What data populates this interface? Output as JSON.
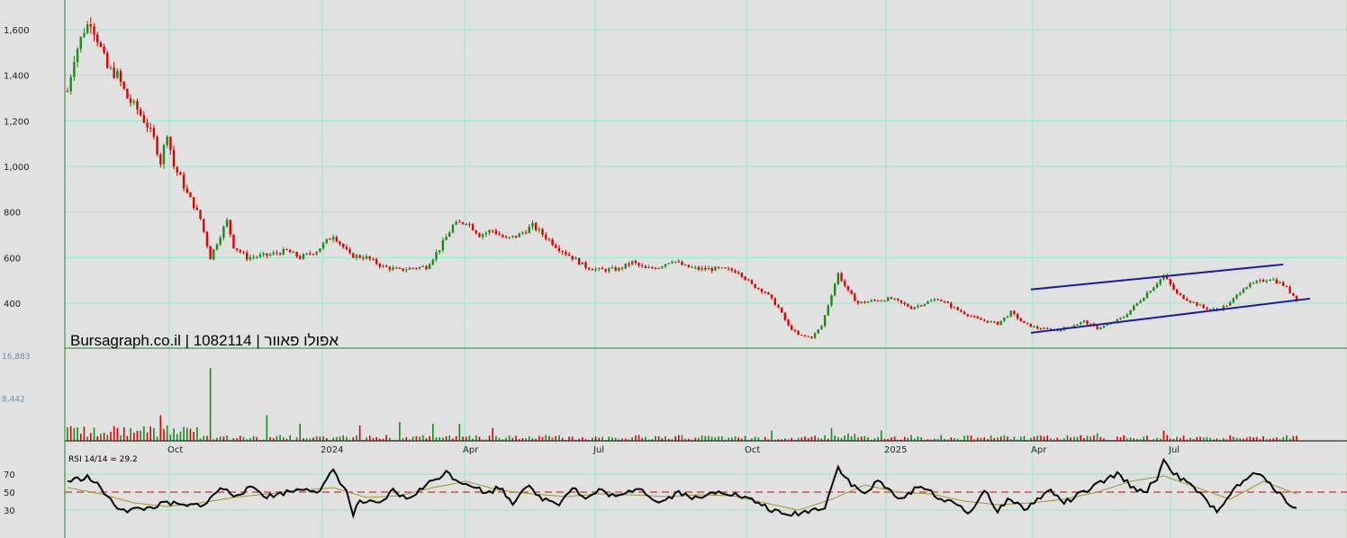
{
  "header": {
    "title": "Bursagraph.co.il | 1082114 | אפולו פאוור"
  },
  "colors": {
    "up": "#1a8a1a",
    "down": "#e00000",
    "grid": "#8ff0c8",
    "channel": "#1a1a9c",
    "rsi": "#000000",
    "rsi_ma": "#9a9a2a",
    "rsi_mid": "#d83030"
  },
  "chart_data": {
    "type": "candlestick",
    "price_axis": {
      "ticks": [
        400,
        600,
        800,
        1000,
        1200,
        1400,
        1600
      ],
      "tick_labels": [
        "400",
        "600",
        "800",
        "1,000",
        "1,200",
        "1,400",
        "1,600"
      ]
    },
    "volume_axis": {
      "ticks": [
        8442,
        16883
      ],
      "tick_labels": [
        "8,442",
        "16,883"
      ]
    },
    "rsi": {
      "label": "RSI 14/14 = 29.2",
      "ticks": [
        30,
        50,
        70
      ],
      "tick_labels": [
        "30",
        "50",
        "70"
      ],
      "last": 29.2
    },
    "x_labels": [
      "Oct",
      "2024",
      "Apr",
      "Jul",
      "Oct",
      "2025",
      "Apr",
      "Jul"
    ],
    "price_path": [
      [
        0,
        1330
      ],
      [
        2,
        1480
      ],
      [
        5,
        1600
      ],
      [
        7,
        1640
      ],
      [
        9,
        1560
      ],
      [
        12,
        1430
      ],
      [
        15,
        1400
      ],
      [
        18,
        1300
      ],
      [
        21,
        1250
      ],
      [
        24,
        1180
      ],
      [
        26,
        1120
      ],
      [
        28,
        1020
      ],
      [
        30,
        1150
      ],
      [
        32,
        1000
      ],
      [
        34,
        950
      ],
      [
        36,
        880
      ],
      [
        38,
        830
      ],
      [
        40,
        770
      ],
      [
        43,
        600
      ],
      [
        46,
        700
      ],
      [
        48,
        760
      ],
      [
        50,
        650
      ],
      [
        54,
        600
      ],
      [
        60,
        610
      ],
      [
        66,
        630
      ],
      [
        70,
        600
      ],
      [
        75,
        630
      ],
      [
        80,
        700
      ],
      [
        85,
        610
      ],
      [
        90,
        600
      ],
      [
        95,
        560
      ],
      [
        100,
        545
      ],
      [
        104,
        555
      ],
      [
        108,
        560
      ],
      [
        112,
        640
      ],
      [
        116,
        740
      ],
      [
        120,
        760
      ],
      [
        124,
        700
      ],
      [
        128,
        720
      ],
      [
        132,
        680
      ],
      [
        136,
        700
      ],
      [
        140,
        740
      ],
      [
        144,
        690
      ],
      [
        148,
        640
      ],
      [
        152,
        600
      ],
      [
        156,
        560
      ],
      [
        160,
        545
      ],
      [
        166,
        550
      ],
      [
        170,
        580
      ],
      [
        174,
        550
      ],
      [
        178,
        560
      ],
      [
        182,
        590
      ],
      [
        186,
        560
      ],
      [
        190,
        550
      ],
      [
        196,
        550
      ],
      [
        202,
        540
      ],
      [
        206,
        480
      ],
      [
        210,
        450
      ],
      [
        214,
        380
      ],
      [
        217,
        300
      ],
      [
        220,
        260
      ],
      [
        224,
        250
      ],
      [
        227,
        300
      ],
      [
        230,
        440
      ],
      [
        232,
        530
      ],
      [
        235,
        450
      ],
      [
        238,
        400
      ],
      [
        242,
        410
      ],
      [
        248,
        420
      ],
      [
        254,
        380
      ],
      [
        258,
        400
      ],
      [
        262,
        420
      ],
      [
        268,
        370
      ],
      [
        274,
        330
      ],
      [
        280,
        310
      ],
      [
        284,
        360
      ],
      [
        288,
        310
      ],
      [
        292,
        290
      ],
      [
        298,
        280
      ],
      [
        302,
        300
      ],
      [
        306,
        320
      ],
      [
        310,
        290
      ],
      [
        314,
        310
      ],
      [
        318,
        340
      ],
      [
        322,
        400
      ],
      [
        326,
        460
      ],
      [
        330,
        520
      ],
      [
        334,
        440
      ],
      [
        338,
        410
      ],
      [
        342,
        380
      ],
      [
        346,
        370
      ],
      [
        350,
        400
      ],
      [
        354,
        470
      ],
      [
        358,
        490
      ],
      [
        362,
        510
      ],
      [
        366,
        480
      ],
      [
        368,
        450
      ],
      [
        370,
        420
      ]
    ],
    "rsi_path": [
      [
        0,
        62
      ],
      [
        6,
        67
      ],
      [
        10,
        55
      ],
      [
        14,
        35
      ],
      [
        18,
        30
      ],
      [
        24,
        32
      ],
      [
        30,
        38
      ],
      [
        36,
        34
      ],
      [
        42,
        38
      ],
      [
        46,
        55
      ],
      [
        50,
        47
      ],
      [
        56,
        55
      ],
      [
        60,
        45
      ],
      [
        66,
        50
      ],
      [
        72,
        55
      ],
      [
        76,
        50
      ],
      [
        80,
        75
      ],
      [
        84,
        50
      ],
      [
        86,
        25
      ],
      [
        88,
        40
      ],
      [
        94,
        36
      ],
      [
        98,
        52
      ],
      [
        102,
        42
      ],
      [
        106,
        52
      ],
      [
        110,
        63
      ],
      [
        114,
        72
      ],
      [
        118,
        62
      ],
      [
        122,
        58
      ],
      [
        126,
        48
      ],
      [
        130,
        56
      ],
      [
        134,
        38
      ],
      [
        138,
        58
      ],
      [
        142,
        44
      ],
      [
        148,
        38
      ],
      [
        152,
        56
      ],
      [
        156,
        42
      ],
      [
        160,
        52
      ],
      [
        166,
        44
      ],
      [
        172,
        56
      ],
      [
        178,
        38
      ],
      [
        184,
        50
      ],
      [
        190,
        42
      ],
      [
        196,
        52
      ],
      [
        202,
        46
      ],
      [
        208,
        38
      ],
      [
        212,
        30
      ],
      [
        216,
        24
      ],
      [
        222,
        28
      ],
      [
        228,
        34
      ],
      [
        232,
        78
      ],
      [
        236,
        58
      ],
      [
        240,
        48
      ],
      [
        244,
        62
      ],
      [
        248,
        50
      ],
      [
        252,
        42
      ],
      [
        256,
        58
      ],
      [
        260,
        50
      ],
      [
        264,
        40
      ],
      [
        268,
        36
      ],
      [
        272,
        26
      ],
      [
        276,
        54
      ],
      [
        280,
        28
      ],
      [
        284,
        44
      ],
      [
        288,
        30
      ],
      [
        292,
        42
      ],
      [
        296,
        52
      ],
      [
        300,
        38
      ],
      [
        306,
        50
      ],
      [
        312,
        62
      ],
      [
        316,
        70
      ],
      [
        320,
        58
      ],
      [
        324,
        48
      ],
      [
        328,
        66
      ],
      [
        330,
        85
      ],
      [
        334,
        68
      ],
      [
        340,
        52
      ],
      [
        344,
        34
      ],
      [
        346,
        30
      ],
      [
        350,
        48
      ],
      [
        354,
        62
      ],
      [
        358,
        72
      ],
      [
        362,
        58
      ],
      [
        366,
        46
      ],
      [
        368,
        36
      ],
      [
        370,
        30
      ]
    ],
    "rsi_ma_path": [
      [
        0,
        55
      ],
      [
        10,
        48
      ],
      [
        20,
        38
      ],
      [
        30,
        34
      ],
      [
        40,
        38
      ],
      [
        50,
        44
      ],
      [
        60,
        48
      ],
      [
        70,
        52
      ],
      [
        80,
        55
      ],
      [
        90,
        44
      ],
      [
        100,
        46
      ],
      [
        110,
        55
      ],
      [
        120,
        62
      ],
      [
        130,
        52
      ],
      [
        140,
        48
      ],
      [
        150,
        45
      ],
      [
        160,
        48
      ],
      [
        170,
        47
      ],
      [
        180,
        45
      ],
      [
        190,
        47
      ],
      [
        200,
        46
      ],
      [
        210,
        38
      ],
      [
        220,
        30
      ],
      [
        230,
        42
      ],
      [
        240,
        58
      ],
      [
        250,
        50
      ],
      [
        260,
        48
      ],
      [
        270,
        40
      ],
      [
        280,
        36
      ],
      [
        290,
        38
      ],
      [
        300,
        42
      ],
      [
        310,
        50
      ],
      [
        320,
        62
      ],
      [
        330,
        68
      ],
      [
        340,
        55
      ],
      [
        350,
        42
      ],
      [
        360,
        62
      ],
      [
        370,
        48
      ]
    ],
    "volume_spikes": [
      [
        2,
        15
      ],
      [
        28,
        30
      ],
      [
        43,
        85
      ],
      [
        60,
        30
      ],
      [
        70,
        20
      ],
      [
        88,
        18
      ],
      [
        100,
        22
      ],
      [
        110,
        20
      ],
      [
        118,
        20
      ],
      [
        128,
        15
      ],
      [
        212,
        12
      ],
      [
        230,
        15
      ],
      [
        245,
        12
      ],
      [
        310,
        9
      ],
      [
        330,
        12
      ]
    ],
    "channel": {
      "upper": [
        [
          290,
          460
        ],
        [
          366,
          570
        ]
      ],
      "lower": [
        [
          290,
          270
        ],
        [
          374,
          420
        ]
      ]
    }
  }
}
